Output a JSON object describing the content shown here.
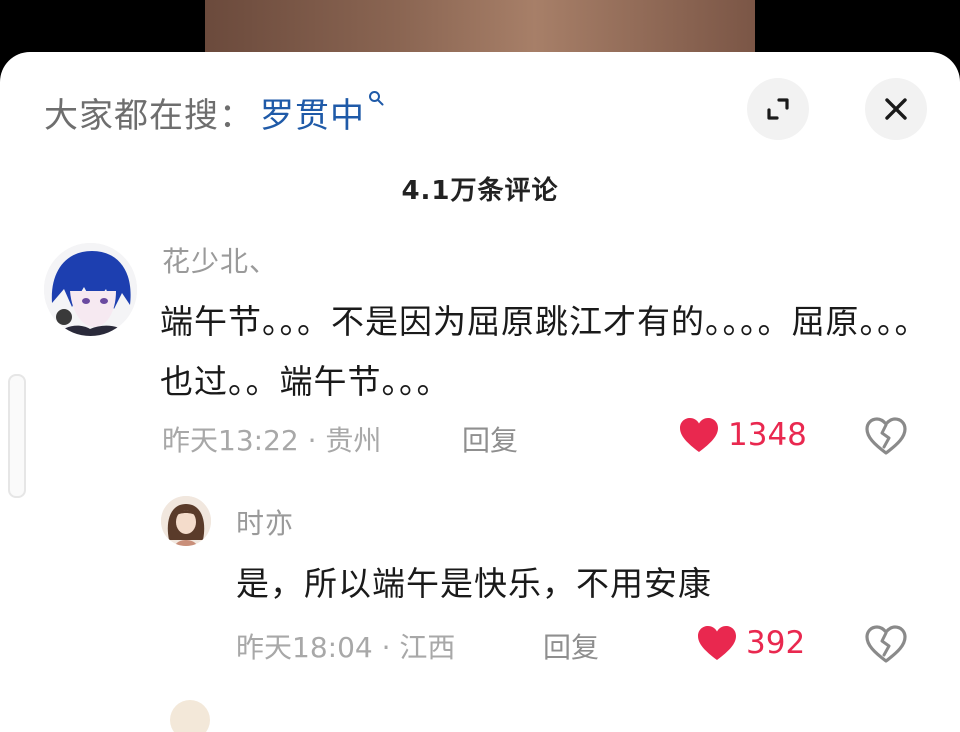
{
  "header": {
    "search_prefix": "大家都在搜：",
    "search_term": "罗贯中",
    "search_icon": "search-icon",
    "expand_icon": "expand-icon",
    "close_icon": "close-icon"
  },
  "comment_count": "4.1万条评论",
  "comments": [
    {
      "username": "花少北、",
      "text": "端午节。。。不是因为屈原跳江才有的。。。。屈原。。。也过。。端午节。。。",
      "time_location": "昨天13:22 · 贵州",
      "reply_label": "回复",
      "likes": "1348",
      "like_color": "#e9284f"
    }
  ],
  "replies": [
    {
      "username": "时亦",
      "text": "是，所以端午是快乐，不用安康",
      "time_location": "昨天18:04 · 江西",
      "reply_label": "回复",
      "likes": "392",
      "like_color": "#e9284f"
    }
  ],
  "colors": {
    "accent_link": "#1f5aa8",
    "like_red": "#e9284f",
    "muted_text": "#a8a8a8"
  }
}
